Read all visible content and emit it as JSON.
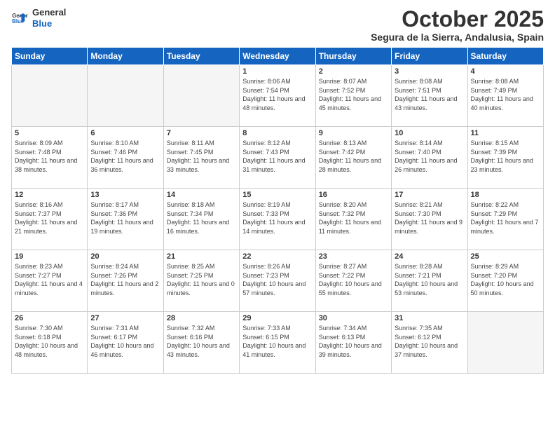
{
  "logo": {
    "line1": "General",
    "line2": "Blue"
  },
  "title": "October 2025",
  "subtitle": "Segura de la Sierra, Andalusia, Spain",
  "days_header": [
    "Sunday",
    "Monday",
    "Tuesday",
    "Wednesday",
    "Thursday",
    "Friday",
    "Saturday"
  ],
  "weeks": [
    [
      {
        "day": "",
        "info": ""
      },
      {
        "day": "",
        "info": ""
      },
      {
        "day": "",
        "info": ""
      },
      {
        "day": "1",
        "info": "Sunrise: 8:06 AM\nSunset: 7:54 PM\nDaylight: 11 hours and 48 minutes."
      },
      {
        "day": "2",
        "info": "Sunrise: 8:07 AM\nSunset: 7:52 PM\nDaylight: 11 hours and 45 minutes."
      },
      {
        "day": "3",
        "info": "Sunrise: 8:08 AM\nSunset: 7:51 PM\nDaylight: 11 hours and 43 minutes."
      },
      {
        "day": "4",
        "info": "Sunrise: 8:08 AM\nSunset: 7:49 PM\nDaylight: 11 hours and 40 minutes."
      }
    ],
    [
      {
        "day": "5",
        "info": "Sunrise: 8:09 AM\nSunset: 7:48 PM\nDaylight: 11 hours and 38 minutes."
      },
      {
        "day": "6",
        "info": "Sunrise: 8:10 AM\nSunset: 7:46 PM\nDaylight: 11 hours and 36 minutes."
      },
      {
        "day": "7",
        "info": "Sunrise: 8:11 AM\nSunset: 7:45 PM\nDaylight: 11 hours and 33 minutes."
      },
      {
        "day": "8",
        "info": "Sunrise: 8:12 AM\nSunset: 7:43 PM\nDaylight: 11 hours and 31 minutes."
      },
      {
        "day": "9",
        "info": "Sunrise: 8:13 AM\nSunset: 7:42 PM\nDaylight: 11 hours and 28 minutes."
      },
      {
        "day": "10",
        "info": "Sunrise: 8:14 AM\nSunset: 7:40 PM\nDaylight: 11 hours and 26 minutes."
      },
      {
        "day": "11",
        "info": "Sunrise: 8:15 AM\nSunset: 7:39 PM\nDaylight: 11 hours and 23 minutes."
      }
    ],
    [
      {
        "day": "12",
        "info": "Sunrise: 8:16 AM\nSunset: 7:37 PM\nDaylight: 11 hours and 21 minutes."
      },
      {
        "day": "13",
        "info": "Sunrise: 8:17 AM\nSunset: 7:36 PM\nDaylight: 11 hours and 19 minutes."
      },
      {
        "day": "14",
        "info": "Sunrise: 8:18 AM\nSunset: 7:34 PM\nDaylight: 11 hours and 16 minutes."
      },
      {
        "day": "15",
        "info": "Sunrise: 8:19 AM\nSunset: 7:33 PM\nDaylight: 11 hours and 14 minutes."
      },
      {
        "day": "16",
        "info": "Sunrise: 8:20 AM\nSunset: 7:32 PM\nDaylight: 11 hours and 11 minutes."
      },
      {
        "day": "17",
        "info": "Sunrise: 8:21 AM\nSunset: 7:30 PM\nDaylight: 11 hours and 9 minutes."
      },
      {
        "day": "18",
        "info": "Sunrise: 8:22 AM\nSunset: 7:29 PM\nDaylight: 11 hours and 7 minutes."
      }
    ],
    [
      {
        "day": "19",
        "info": "Sunrise: 8:23 AM\nSunset: 7:27 PM\nDaylight: 11 hours and 4 minutes."
      },
      {
        "day": "20",
        "info": "Sunrise: 8:24 AM\nSunset: 7:26 PM\nDaylight: 11 hours and 2 minutes."
      },
      {
        "day": "21",
        "info": "Sunrise: 8:25 AM\nSunset: 7:25 PM\nDaylight: 11 hours and 0 minutes."
      },
      {
        "day": "22",
        "info": "Sunrise: 8:26 AM\nSunset: 7:23 PM\nDaylight: 10 hours and 57 minutes."
      },
      {
        "day": "23",
        "info": "Sunrise: 8:27 AM\nSunset: 7:22 PM\nDaylight: 10 hours and 55 minutes."
      },
      {
        "day": "24",
        "info": "Sunrise: 8:28 AM\nSunset: 7:21 PM\nDaylight: 10 hours and 53 minutes."
      },
      {
        "day": "25",
        "info": "Sunrise: 8:29 AM\nSunset: 7:20 PM\nDaylight: 10 hours and 50 minutes."
      }
    ],
    [
      {
        "day": "26",
        "info": "Sunrise: 7:30 AM\nSunset: 6:18 PM\nDaylight: 10 hours and 48 minutes."
      },
      {
        "day": "27",
        "info": "Sunrise: 7:31 AM\nSunset: 6:17 PM\nDaylight: 10 hours and 46 minutes."
      },
      {
        "day": "28",
        "info": "Sunrise: 7:32 AM\nSunset: 6:16 PM\nDaylight: 10 hours and 43 minutes."
      },
      {
        "day": "29",
        "info": "Sunrise: 7:33 AM\nSunset: 6:15 PM\nDaylight: 10 hours and 41 minutes."
      },
      {
        "day": "30",
        "info": "Sunrise: 7:34 AM\nSunset: 6:13 PM\nDaylight: 10 hours and 39 minutes."
      },
      {
        "day": "31",
        "info": "Sunrise: 7:35 AM\nSunset: 6:12 PM\nDaylight: 10 hours and 37 minutes."
      },
      {
        "day": "",
        "info": ""
      }
    ]
  ]
}
